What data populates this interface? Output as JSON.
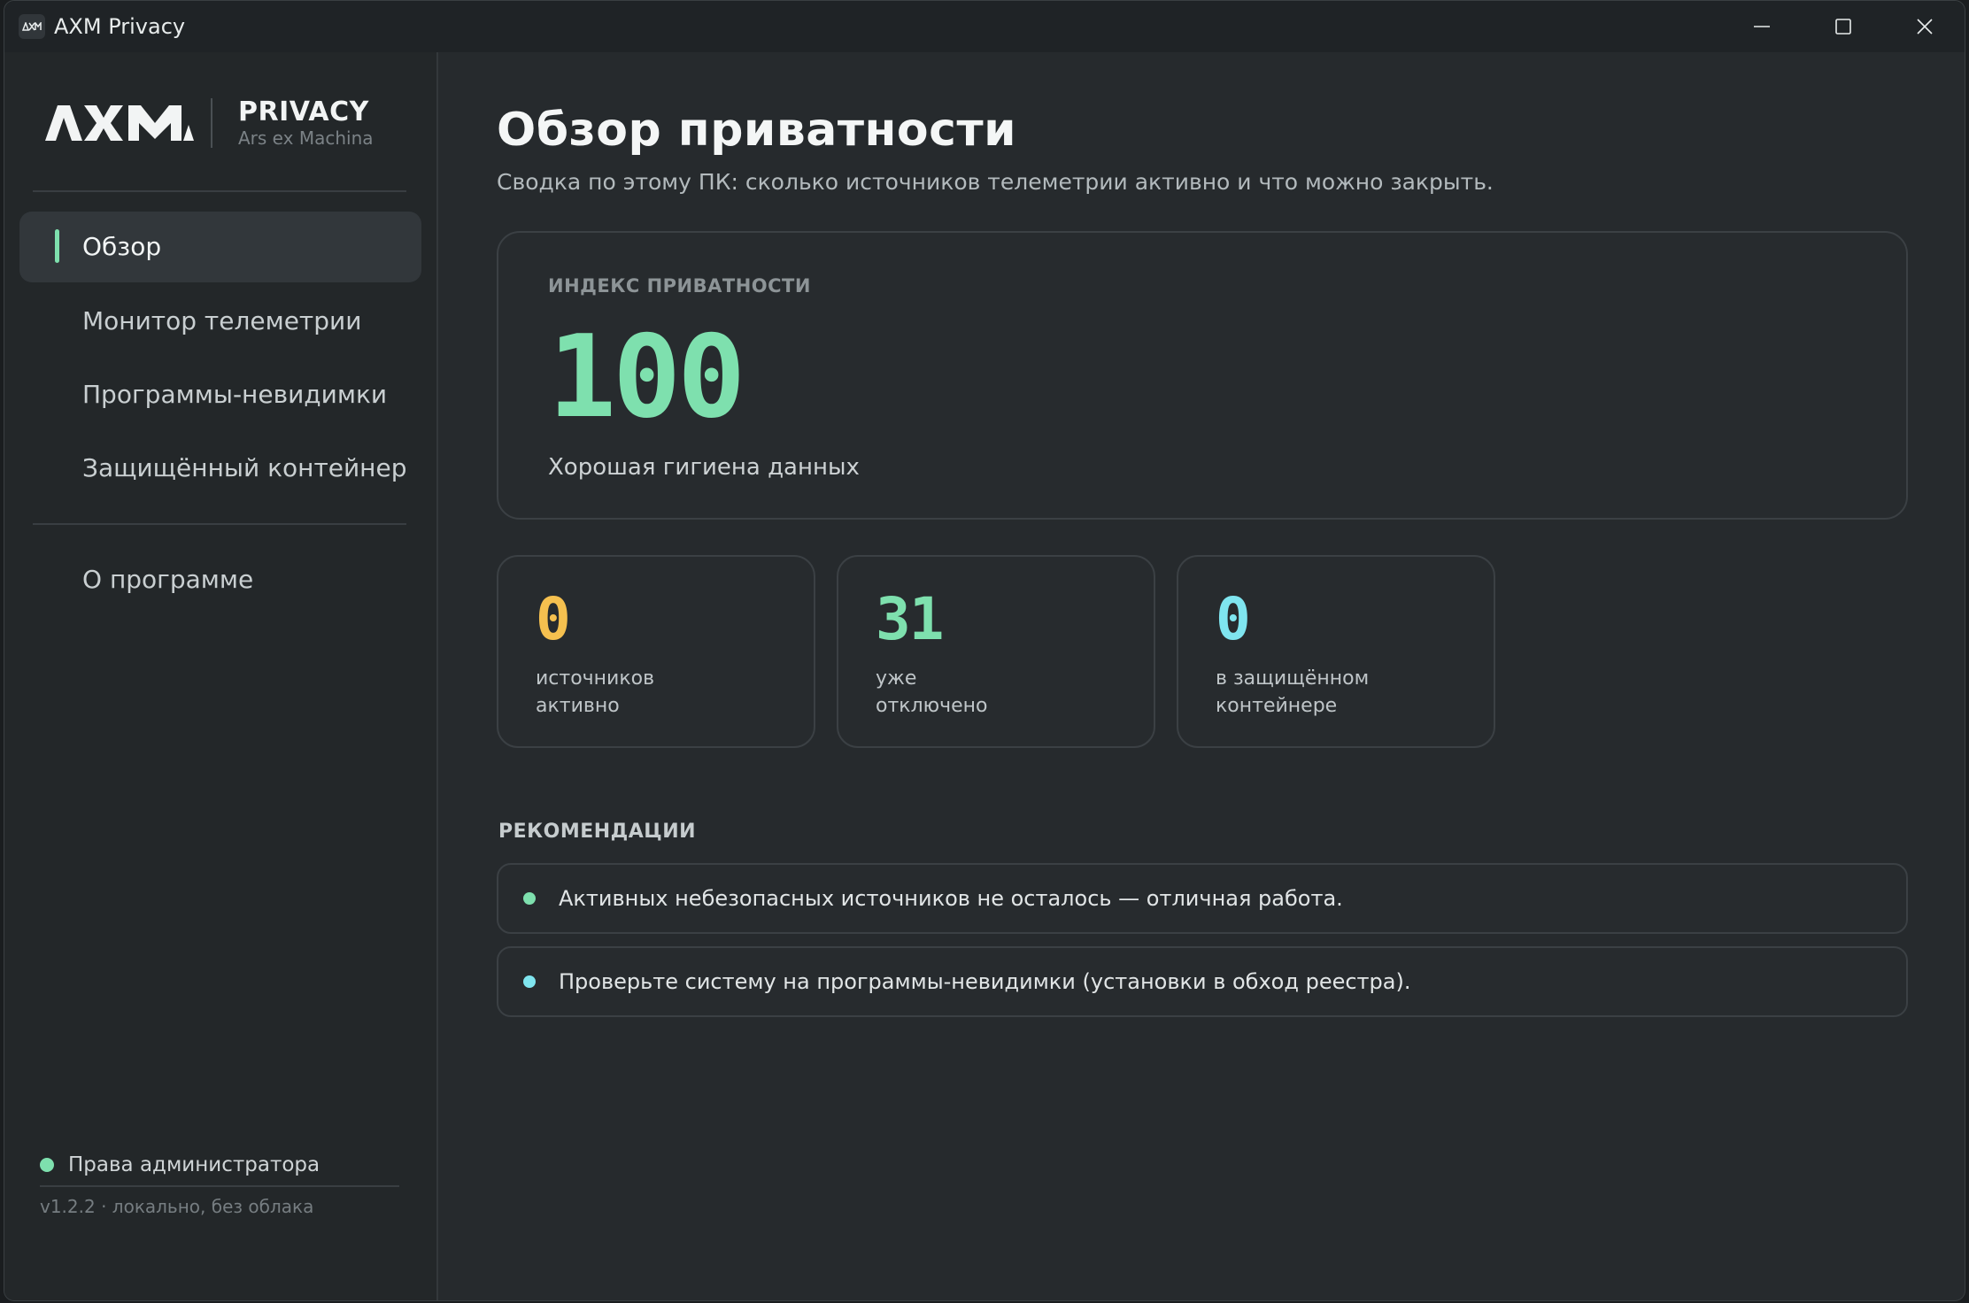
{
  "window": {
    "title": "AXM Privacy"
  },
  "brand": {
    "title": "PRIVACY",
    "subtitle": "Ars ex Machina"
  },
  "sidebar": {
    "items": [
      {
        "label": "Обзор"
      },
      {
        "label": "Монитор телеметрии"
      },
      {
        "label": "Программы-невидимки"
      },
      {
        "label": "Защищённый контейнер"
      },
      {
        "label": "О программе"
      }
    ],
    "active_index": 0,
    "status": {
      "admin_label": "Права администратора",
      "version_label": "v1.2.2 · локально, без облака"
    }
  },
  "main": {
    "title": "Обзор приватности",
    "subtitle": "Сводка по этому ПК: сколько источников телеметрии активно и что можно закрыть.",
    "index_card": {
      "label": "ИНДЕКС ПРИВАТНОСТИ",
      "value": "100",
      "caption": "Хорошая гигиена данных"
    },
    "stats": [
      {
        "value": "0",
        "line1": "источников",
        "line2": "активно",
        "color": "#f5c04f"
      },
      {
        "value": "31",
        "line1": "уже",
        "line2": "отключено",
        "color": "#7ee0ae"
      },
      {
        "value": "0",
        "line1": "в защищённом",
        "line2": "контейнере",
        "color": "#7fe5ef"
      }
    ],
    "recommendations": {
      "heading": "РЕКОМЕНДАЦИИ",
      "items": [
        {
          "text": "Активных небезопасных источников не осталось — отличная работа.",
          "color": "#7ee0ae"
        },
        {
          "text": "Проверьте систему на программы-невидимки (установки в обход реестра).",
          "color": "#7fe5ef"
        }
      ]
    }
  },
  "colors": {
    "accent": "#7ee0ae",
    "warning": "#f5c04f",
    "info": "#7fe5ef"
  },
  "icons": {
    "app": "axm-logo-icon",
    "minimize": "minimize-icon",
    "maximize": "maximize-icon",
    "close": "close-icon"
  }
}
